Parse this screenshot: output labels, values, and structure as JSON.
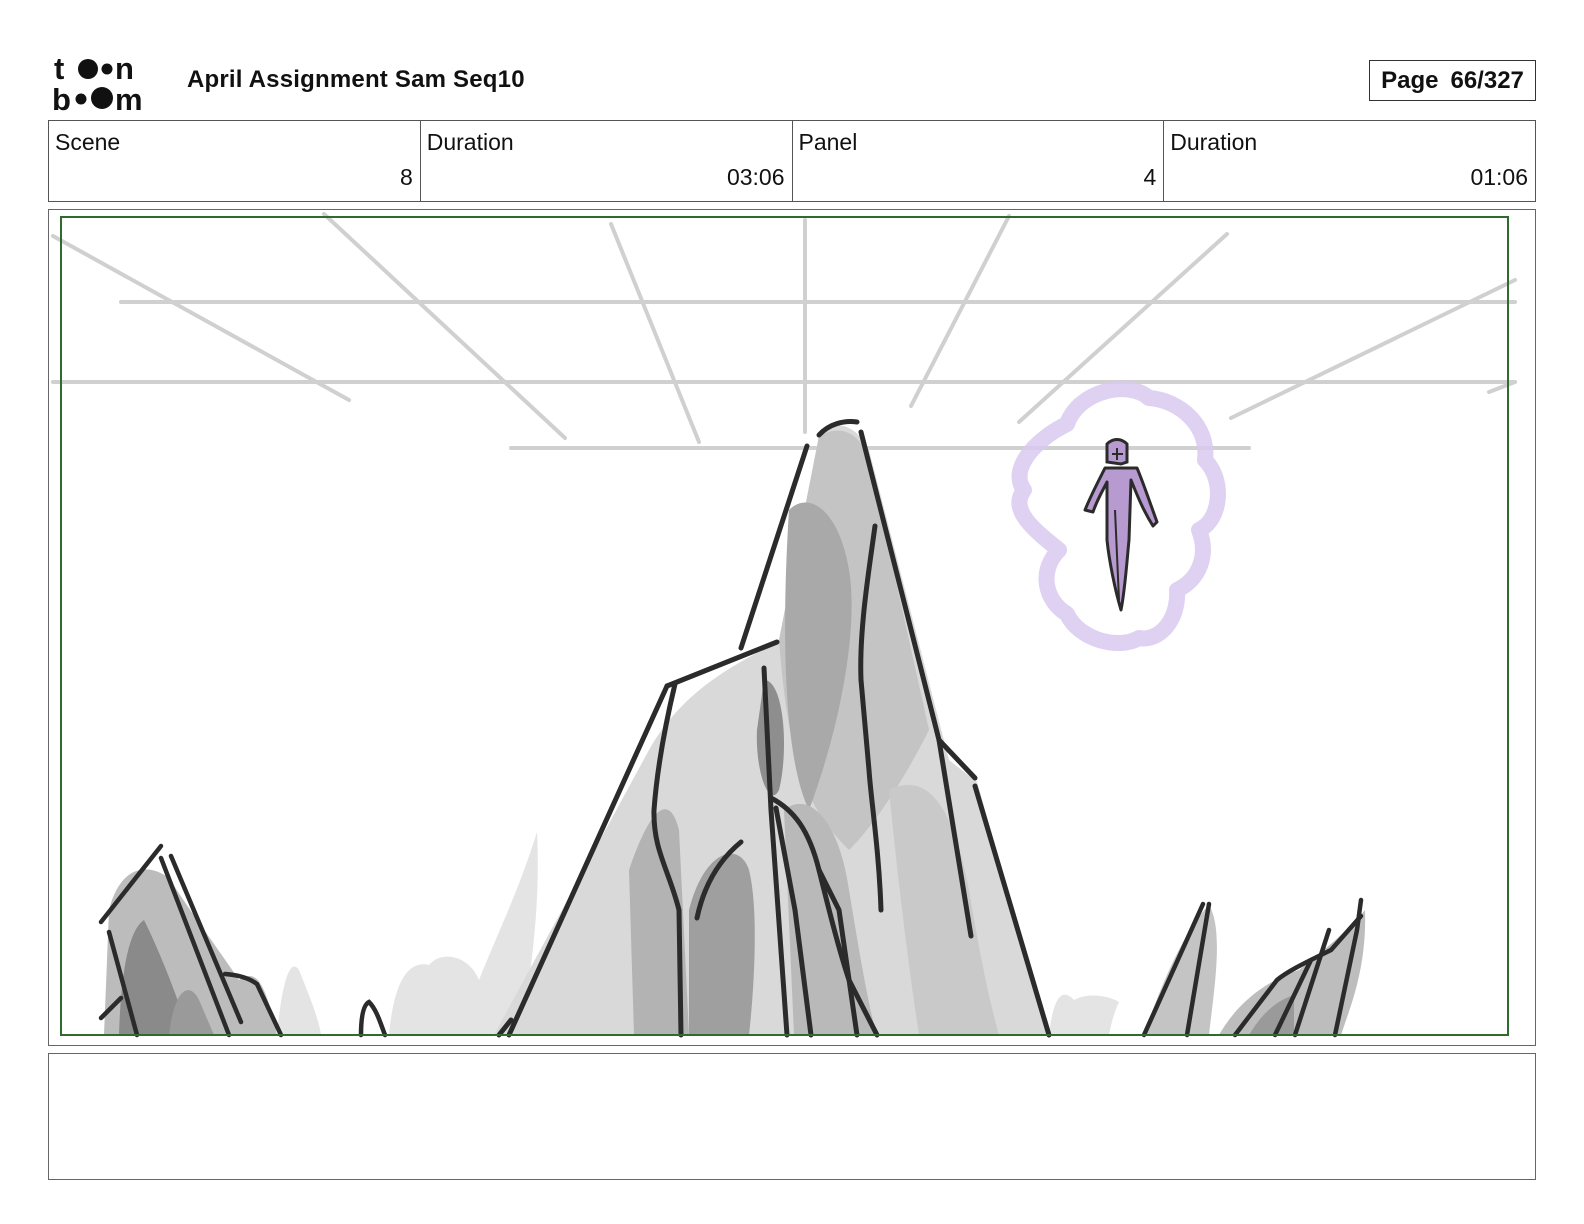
{
  "header": {
    "logo_text": "toonboom",
    "project_title": "April Assignment Sam Seq10",
    "page_label": "Page",
    "page_value": "66/327"
  },
  "info": [
    {
      "label": "Scene",
      "value": "8"
    },
    {
      "label": "Duration",
      "value": "03:06"
    },
    {
      "label": "Panel",
      "value": "4"
    },
    {
      "label": "Duration",
      "value": "01:06"
    }
  ],
  "panel": {
    "description": "",
    "colors": {
      "safe_frame": "#2e6b2e",
      "line_art": "#2b2b2b",
      "guide_lines": "#cfcfcf",
      "figure": "#b79ad0",
      "aura": "#d9c9ee"
    }
  },
  "notes": {
    "text": ""
  }
}
